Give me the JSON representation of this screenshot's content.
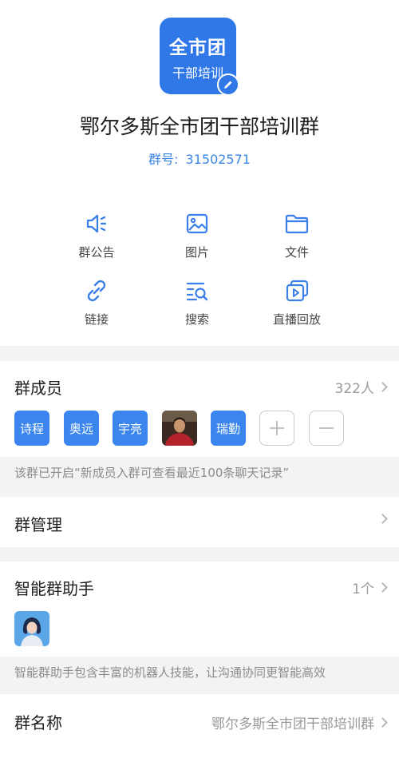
{
  "header": {
    "avatar_line1": "全市团",
    "avatar_line2": "干部培训",
    "group_name": "鄂尔多斯全市团干部培训群",
    "group_id_label": "群号:",
    "group_id": "31502571"
  },
  "actions": [
    {
      "label": "群公告",
      "icon": "announcement-icon"
    },
    {
      "label": "图片",
      "icon": "image-icon"
    },
    {
      "label": "文件",
      "icon": "folder-icon"
    },
    {
      "label": "链接",
      "icon": "link-icon"
    },
    {
      "label": "搜索",
      "icon": "search-list-icon"
    },
    {
      "label": "直播回放",
      "icon": "live-replay-icon"
    }
  ],
  "members": {
    "title": "群成员",
    "count": "322人",
    "list": [
      "诗程",
      "奥远",
      "宇亮",
      "",
      "瑞勤"
    ],
    "hint": "该群已开启“新成员入群可查看最近100条聊天记录”"
  },
  "management": {
    "title": "群管理"
  },
  "assistant": {
    "title": "智能群助手",
    "count": "1个",
    "hint": "智能群助手包含丰富的机器人技能，让沟通协同更智能高效"
  },
  "group_name_row": {
    "title": "群名称",
    "value": "鄂尔多斯全市团干部培训群"
  },
  "colors": {
    "accent": "#3078e8",
    "link": "#3a86e6",
    "background": "#f2f3f5"
  }
}
